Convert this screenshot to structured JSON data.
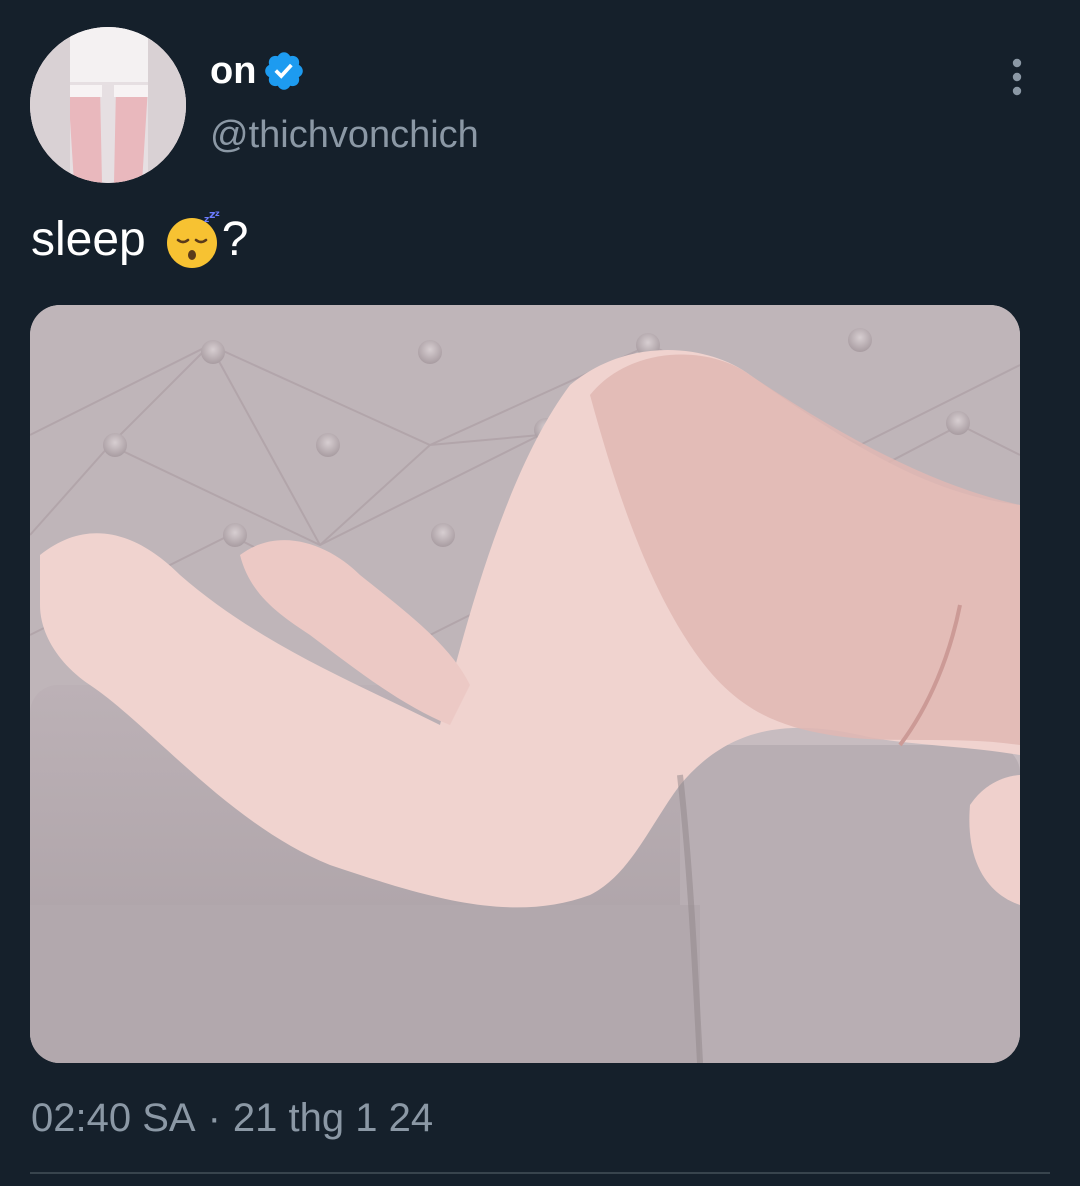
{
  "author": {
    "display_name": "on",
    "handle": "@thichvonchich",
    "verified": true,
    "avatar": "avatar-image"
  },
  "menu_icon": "more-vertical-icon",
  "tweet": {
    "text_word": "sleep",
    "emoji": "sleeping-face-emoji",
    "text_suffix": "?"
  },
  "media": {
    "kind": "photo",
    "icon": "photo-media"
  },
  "timestamp": {
    "time": "02:40 SA",
    "separator": "·",
    "date": "21 thg 1 24"
  },
  "colors": {
    "background": "#15202b",
    "primary_text": "#ffffff",
    "secondary_text": "#8b98a5",
    "verified_badge": "#1d9bf0",
    "divider": "#38444d"
  }
}
